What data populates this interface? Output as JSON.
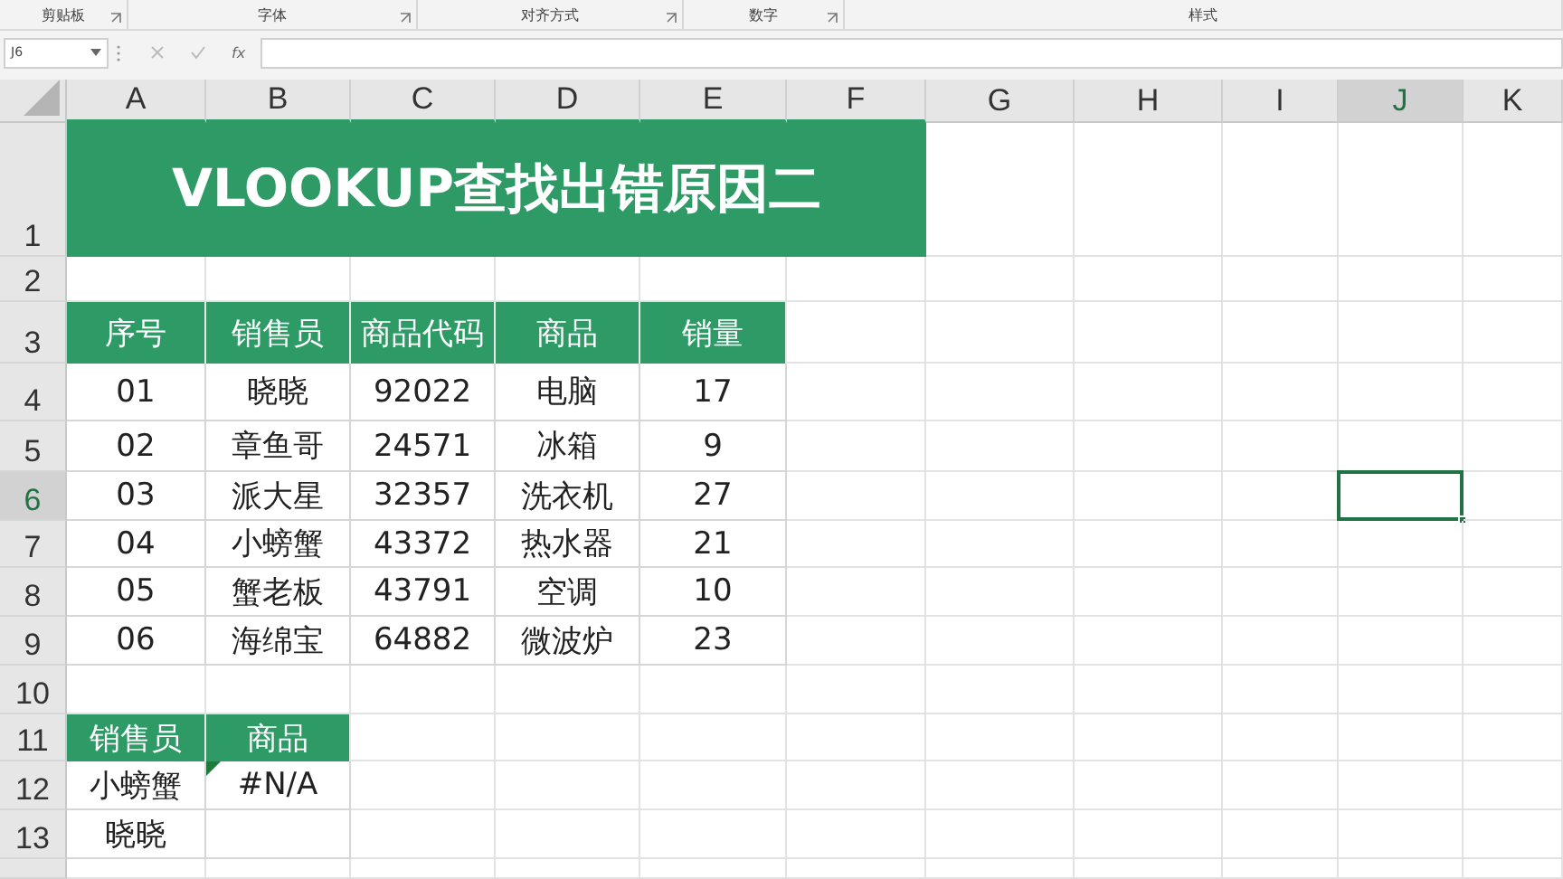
{
  "ribbon_groups": [
    {
      "label": "剪贴板",
      "launcher": true
    },
    {
      "label": "字体",
      "launcher": true
    },
    {
      "label": "对齐方式",
      "launcher": true
    },
    {
      "label": "数字",
      "launcher": true
    },
    {
      "label": "样式",
      "launcher": false
    }
  ],
  "formula_bar": {
    "name_box": "J6",
    "fx": "fx"
  },
  "columns": [
    {
      "label": "A",
      "selected": false
    },
    {
      "label": "B",
      "selected": false
    },
    {
      "label": "C",
      "selected": false
    },
    {
      "label": "D",
      "selected": false
    },
    {
      "label": "E",
      "selected": false
    },
    {
      "label": "F",
      "selected": false
    },
    {
      "label": "G",
      "selected": false
    },
    {
      "label": "H",
      "selected": false
    },
    {
      "label": "I",
      "selected": false
    },
    {
      "label": "J",
      "selected": true
    },
    {
      "label": "K",
      "selected": false
    }
  ],
  "rows": [
    {
      "label": "1",
      "selected": false
    },
    {
      "label": "2",
      "selected": false
    },
    {
      "label": "3",
      "selected": false
    },
    {
      "label": "4",
      "selected": false
    },
    {
      "label": "5",
      "selected": false
    },
    {
      "label": "6",
      "selected": true
    },
    {
      "label": "7",
      "selected": false
    },
    {
      "label": "8",
      "selected": false
    },
    {
      "label": "9",
      "selected": false
    },
    {
      "label": "10",
      "selected": false
    },
    {
      "label": "11",
      "selected": false
    },
    {
      "label": "12",
      "selected": false
    },
    {
      "label": "13",
      "selected": false
    }
  ],
  "title": "VLOOKUP查找出错原因二",
  "table": {
    "columns": [
      "序号",
      "销售员",
      "商品代码",
      "商品",
      "销量"
    ],
    "rows": [
      [
        "01",
        "晓晓",
        "92022",
        "电脑",
        "17"
      ],
      [
        "02",
        "章鱼哥",
        "24571",
        "冰箱",
        "9"
      ],
      [
        "03",
        "派大星",
        "32357",
        "洗衣机",
        "27"
      ],
      [
        "04",
        "小螃蟹",
        "43372",
        "热水器",
        "21"
      ],
      [
        "05",
        "蟹老板",
        "43791",
        "空调",
        "10"
      ],
      [
        "06",
        "海绵宝",
        "64882",
        "微波炉",
        "23"
      ]
    ]
  },
  "lookup": {
    "columns": [
      "销售员",
      "商品"
    ],
    "rows": [
      [
        {
          "text": "小螃蟹",
          "error": false
        },
        {
          "text": "#N/A",
          "error": true
        }
      ],
      [
        {
          "text": "晓晓",
          "error": false
        }
      ]
    ]
  }
}
